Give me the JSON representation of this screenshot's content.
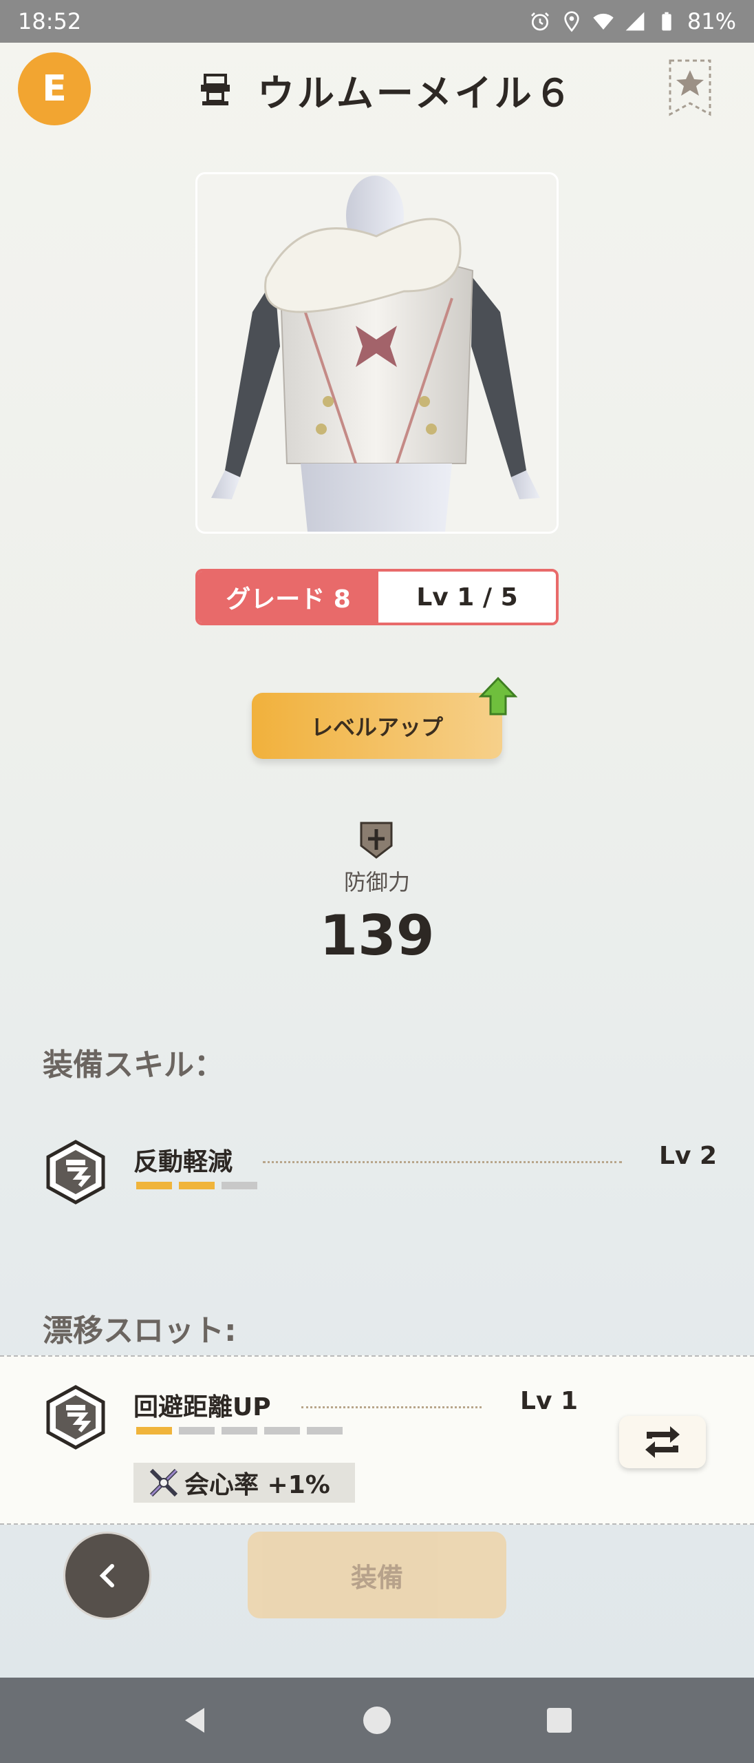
{
  "status": {
    "time": "18:52",
    "battery": "81%"
  },
  "header": {
    "rank": "E",
    "title": "ウルムーメイル６"
  },
  "grade": {
    "label": "グレード 8",
    "level": "Lv 1 / 5"
  },
  "actions": {
    "level_up": "レベルアップ",
    "equip": "装備"
  },
  "defense": {
    "label": "防御力",
    "value": "139"
  },
  "skills": {
    "title": "装備スキル：",
    "items": [
      {
        "name": "反動軽減",
        "level": "Lv 2",
        "pips_on": 2,
        "pips_total": 3
      }
    ]
  },
  "slots": {
    "title": "漂移スロット:",
    "items": [
      {
        "name": "回避距離UP",
        "level": "Lv 1",
        "pips_on": 1,
        "pips_total": 5,
        "bonus": "会心率 +1%"
      }
    ]
  },
  "colors": {
    "accent": "#f2a531",
    "grade": "#e86a6a",
    "pip_on": "#f0b43b"
  }
}
